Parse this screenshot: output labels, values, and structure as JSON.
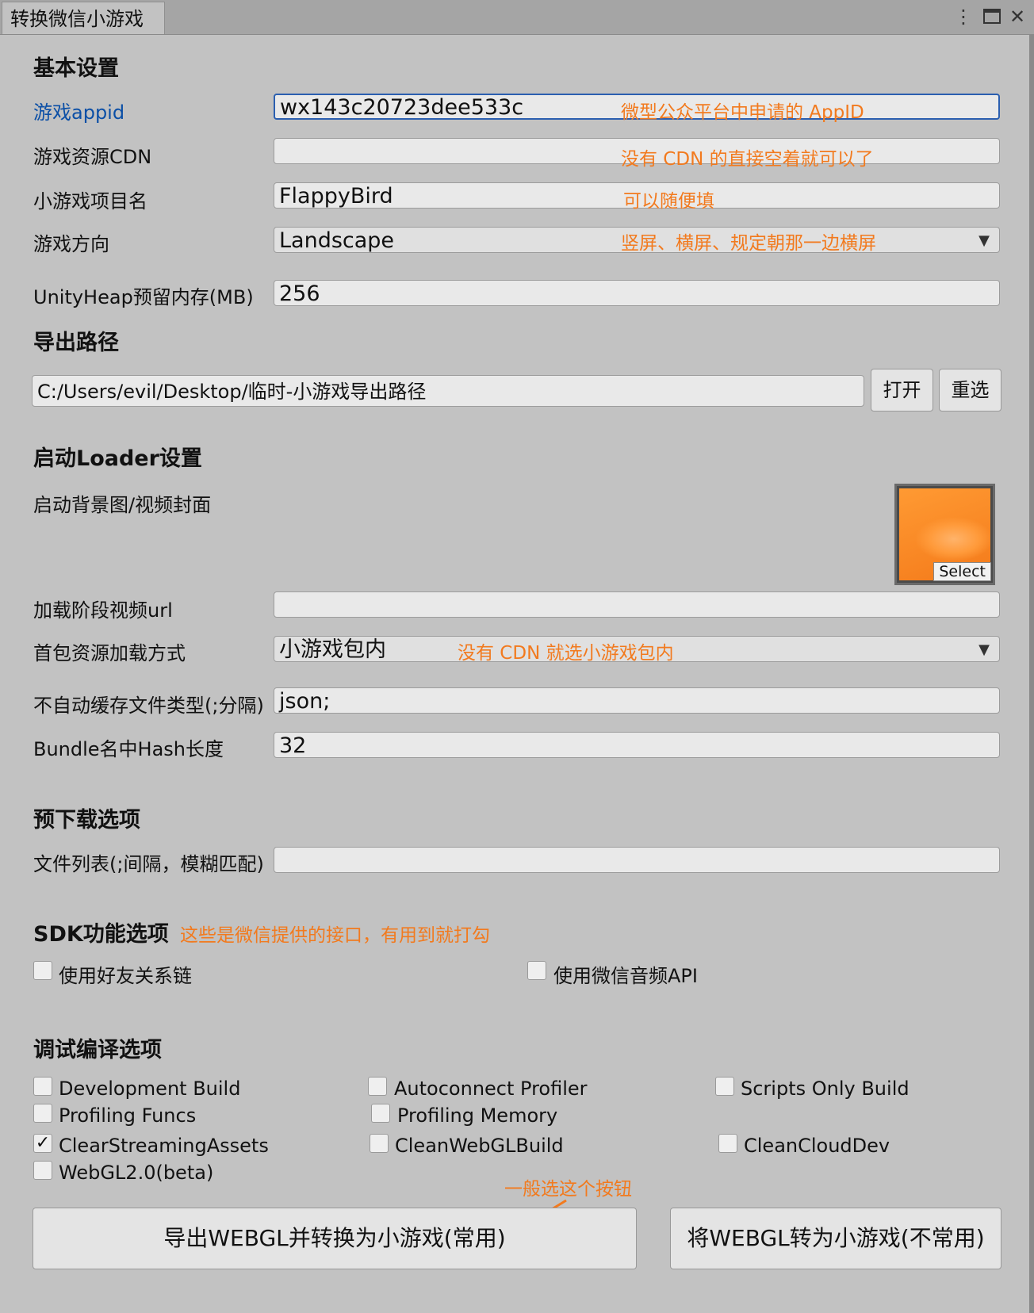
{
  "window": {
    "tab_title": "转换微信小游戏",
    "icons": [
      "more-vertical-icon",
      "maximize-icon",
      "close-icon"
    ]
  },
  "basic": {
    "heading": "基本设置",
    "appid_label": "游戏appid",
    "appid_value": "wx143c20723dee533c",
    "appid_note": "微型公众平台中申请的 AppID",
    "cdn_label": "游戏资源CDN",
    "cdn_value": "",
    "cdn_note": "没有 CDN 的直接空着就可以了",
    "project_label": "小游戏项目名",
    "project_value": "FlappyBird",
    "project_note": "可以随便填",
    "orientation_label": "游戏方向",
    "orientation_value": "Landscape",
    "orientation_note": "竖屏、横屏、规定朝那一边横屏",
    "heap_label": "UnityHeap预留内存(MB)",
    "heap_value": "256"
  },
  "export": {
    "heading": "导出路径",
    "path_value": "C:/Users/evil/Desktop/临时-小游戏导出路径",
    "open_label": "打开",
    "reselect_label": "重选"
  },
  "loader": {
    "heading": "启动Loader设置",
    "bg_label": "启动背景图/视频封面",
    "select_label": "Select",
    "video_label": "加载阶段视频url",
    "video_value": "",
    "load_mode_label": "首包资源加载方式",
    "load_mode_value": "小游戏包内",
    "load_mode_note": "没有 CDN 就选小游戏包内",
    "nocache_label": "不自动缓存文件类型(;分隔)",
    "nocache_value": "json;",
    "hash_label": "Bundle名中Hash长度",
    "hash_value": "32"
  },
  "preload": {
    "heading": "预下载选项",
    "files_label": "文件列表(;间隔，模糊匹配)",
    "files_value": ""
  },
  "sdk": {
    "heading": "SDK功能选项",
    "note": "这些是微信提供的接口，有用到就打勾",
    "friends_label": "使用好友关系链",
    "friends_checked": false,
    "audio_label": "使用微信音频API",
    "audio_checked": false
  },
  "debug": {
    "heading": "调试编译选项",
    "options": [
      {
        "label": "Development Build",
        "checked": false
      },
      {
        "label": "Autoconnect Profiler",
        "checked": false
      },
      {
        "label": "Scripts Only Build",
        "checked": false
      },
      {
        "label": "Profiling Funcs",
        "checked": false
      },
      {
        "label": "Profiling Memory",
        "checked": false
      },
      {
        "label": "ClearStreamingAssets",
        "checked": true
      },
      {
        "label": "CleanWebGLBuild",
        "checked": false
      },
      {
        "label": "CleanCloudDev",
        "checked": false
      },
      {
        "label": "WebGL2.0(beta)",
        "checked": false
      }
    ]
  },
  "actions": {
    "primary_label": "导出WEBGL并转换为小游戏(常用)",
    "secondary_label": "将WEBGL转为小游戏(不常用)",
    "hint_note": "一般选这个按钮"
  },
  "colors": {
    "annotation": "#f27a1e",
    "link_label": "#0b4fa6",
    "background": "#c2c2c2"
  }
}
